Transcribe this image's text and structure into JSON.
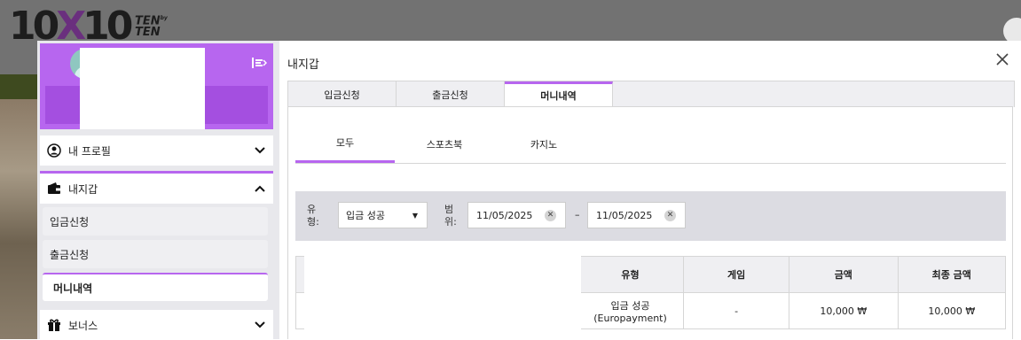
{
  "site": {
    "logo_main": "10X10",
    "logo_sub": "TEN by TEN"
  },
  "sidebar": {
    "items": [
      {
        "label": "내 프로필",
        "icon": "user-circle-icon",
        "state": "collapsed"
      },
      {
        "label": "내지갑",
        "icon": "wallet-icon",
        "state": "expanded",
        "children": [
          "입금신청",
          "출금신청",
          "머니내역"
        ],
        "active_child": "머니내역"
      },
      {
        "label": "보너스",
        "icon": "gift-icon",
        "state": "collapsed"
      }
    ]
  },
  "content": {
    "title": "내지갑",
    "tabs": [
      {
        "label": "입금신청"
      },
      {
        "label": "출금신청"
      },
      {
        "label": "머니내역"
      }
    ],
    "active_tab": "머니내역",
    "subtabs": [
      {
        "label": "모두"
      },
      {
        "label": "스포츠북"
      },
      {
        "label": "카지노"
      }
    ],
    "active_subtab": "모두",
    "filter": {
      "type_label_1": "유",
      "type_label_2": "형:",
      "type_value": "입금 성공",
      "range_label_1": "범",
      "range_label_2": "위:",
      "date_from": "11/05/2025",
      "date_to": "11/05/2025",
      "separator": "–"
    },
    "table": {
      "headers": [
        "유형",
        "게임",
        "금액",
        "최종 금액"
      ],
      "rows": [
        {
          "type_line1": "입금 성공",
          "type_line2": "(Europayment)",
          "game": "-",
          "amount": "10,000 ₩",
          "final": "10,000 ₩"
        }
      ]
    }
  },
  "colors": {
    "accent": "#b766ef",
    "accent_dark": "#a44fe0"
  }
}
